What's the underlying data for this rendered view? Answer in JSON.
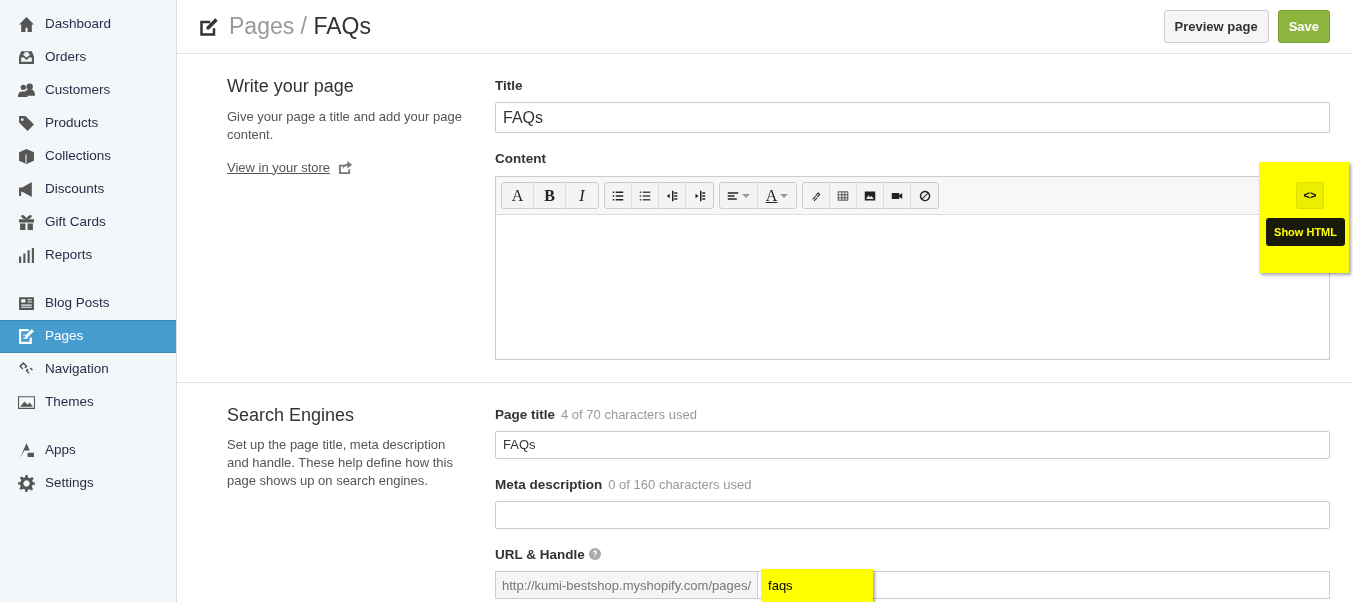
{
  "sidebar": {
    "groups": [
      [
        {
          "label": "Dashboard",
          "selected": false
        },
        {
          "label": "Orders",
          "selected": false
        },
        {
          "label": "Customers",
          "selected": false
        },
        {
          "label": "Products",
          "selected": false
        },
        {
          "label": "Collections",
          "selected": false
        },
        {
          "label": "Discounts",
          "selected": false
        },
        {
          "label": "Gift Cards",
          "selected": false
        },
        {
          "label": "Reports",
          "selected": false
        }
      ],
      [
        {
          "label": "Blog Posts",
          "selected": false
        },
        {
          "label": "Pages",
          "selected": true
        },
        {
          "label": "Navigation",
          "selected": false
        },
        {
          "label": "Themes",
          "selected": false
        }
      ],
      [
        {
          "label": "Apps",
          "selected": false
        },
        {
          "label": "Settings",
          "selected": false
        }
      ]
    ]
  },
  "header": {
    "section": "Pages /",
    "title": "FAQs",
    "buttons": [
      {
        "label": "Preview page",
        "kind": "default"
      },
      {
        "label": "Save",
        "kind": "primary"
      }
    ]
  },
  "sections": [
    {
      "heading": "Write your page",
      "description": "Give your page a title and add your page content.",
      "link": "View in your store",
      "fields": [
        {
          "kind": "text",
          "label": "Title",
          "value": "FAQs"
        },
        {
          "kind": "editor",
          "label": "Content",
          "toolbar": [
            [
              {
                "kind": "letter",
                "label": "A",
                "dropdown": false
              },
              {
                "kind": "letter",
                "label": "B",
                "dropdown": false
              },
              {
                "kind": "letter",
                "label": "I",
                "dropdown": false
              }
            ],
            [
              {
                "kind": "icon",
                "dropdown": false
              },
              {
                "kind": "icon",
                "dropdown": false
              },
              {
                "kind": "icon",
                "dropdown": false
              },
              {
                "kind": "icon",
                "dropdown": false
              }
            ],
            [
              {
                "kind": "icon",
                "dropdown": true
              },
              {
                "kind": "letter",
                "label": "A",
                "dropdown": true
              }
            ],
            [
              {
                "kind": "icon",
                "dropdown": false
              },
              {
                "kind": "icon",
                "dropdown": false
              },
              {
                "kind": "icon",
                "dropdown": false
              },
              {
                "kind": "icon",
                "dropdown": false
              },
              {
                "kind": "icon",
                "dropdown": false
              }
            ]
          ],
          "html_button": {
            "label": "<>",
            "highlighted": true,
            "tooltip": "Show HTML"
          }
        }
      ]
    },
    {
      "heading": "Search Engines",
      "description": "Set up the page title, meta description and handle. These help define how this page shows up on search engines.",
      "fields": [
        {
          "kind": "text",
          "label": "Page title",
          "hint": "4 of 70 characters used",
          "value": "FAQs"
        },
        {
          "kind": "text",
          "label": "Meta description",
          "hint": "0 of 160 characters used"
        },
        {
          "kind": "url",
          "label": "URL & Handle",
          "prefix": "http://kumi-bestshop.myshopify.com/pages/",
          "value": "faqs",
          "highlighted": true
        }
      ]
    }
  ]
}
